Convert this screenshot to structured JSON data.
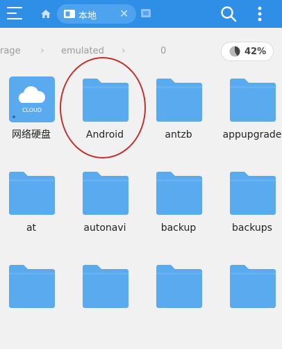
{
  "topbar": {
    "tab_label": "本地",
    "tab_close": "✕",
    "accent_color": "#2f8fe6"
  },
  "breadcrumb": {
    "items": [
      "rage",
      "emulated",
      "0"
    ],
    "separator": "›"
  },
  "storage": {
    "percent_label": "42%",
    "used_fraction": 0.42
  },
  "files": [
    {
      "name": "网络硬盘",
      "icon": "cloud-icon",
      "icon_label": "CLOUD"
    },
    {
      "name": "Android",
      "icon": "folder-icon"
    },
    {
      "name": "antzb",
      "icon": "folder-icon"
    },
    {
      "name": "appupgrade",
      "icon": "folder-icon"
    },
    {
      "name": "at",
      "icon": "folder-icon"
    },
    {
      "name": "autonavi",
      "icon": "folder-icon"
    },
    {
      "name": "backup",
      "icon": "folder-icon"
    },
    {
      "name": "backups",
      "icon": "folder-icon"
    },
    {
      "name": "",
      "icon": "folder-icon"
    },
    {
      "name": "",
      "icon": "folder-icon"
    },
    {
      "name": "",
      "icon": "folder-icon"
    },
    {
      "name": "",
      "icon": "folder-icon"
    }
  ],
  "colors": {
    "folder": "#5aaaf0",
    "folder_tab": "#5aaaf0",
    "cloud_bg": "#5aaaf0",
    "highlight": "#c0312b"
  }
}
